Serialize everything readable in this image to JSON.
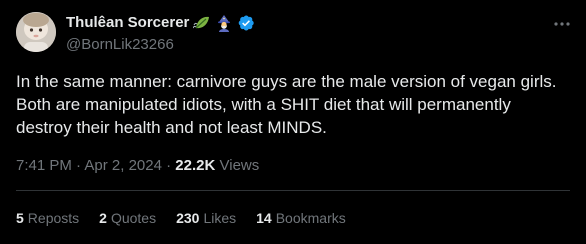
{
  "author": {
    "display_name": "Thulêan Sorcerer",
    "handle": "@BornLik23266",
    "emojis": [
      "leaf-fluttering-emoji",
      "wizard-emoji"
    ],
    "verified": true
  },
  "tweet": {
    "text": "In the same manner: carnivore guys are the male version of vegan girls.\nBoth are manipulated idiots, with a SHIT diet that will permanently\ndestroy their health and not least MINDS.",
    "time": "7:41 PM",
    "separator": "·",
    "date": "Apr 2, 2024",
    "views_count": "22.2K",
    "views_label": "Views"
  },
  "stats": {
    "reposts_count": "5",
    "reposts_label": "Reposts",
    "quotes_count": "2",
    "quotes_label": "Quotes",
    "likes_count": "230",
    "likes_label": "Likes",
    "bookmarks_count": "14",
    "bookmarks_label": "Bookmarks"
  },
  "colors": {
    "background": "#000000",
    "primary_text": "#e7e9ea",
    "secondary_text": "#71767b",
    "verified_blue": "#1d9bf0",
    "divider": "#2f3336"
  }
}
